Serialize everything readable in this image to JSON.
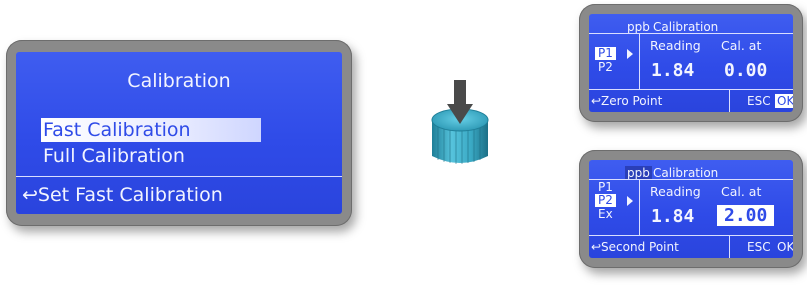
{
  "big_display": {
    "title": "Calibration",
    "menu_items": [
      "Fast Calibration",
      "Full Calibration"
    ],
    "hint": "↩Set Fast Calibration"
  },
  "knob": {
    "icon": "rotary-knob-icon",
    "pointer": "down-arrow-icon"
  },
  "panel_zero": {
    "unit": "ppb",
    "title": "Calibration",
    "points": [
      "P1",
      "P2"
    ],
    "reading_label": "Reading",
    "cal_label": "Cal. at",
    "reading_value": "1.84",
    "cal_value": "0.00",
    "hint": "↩Zero Point",
    "esc": "ESC",
    "ok": "OK"
  },
  "panel_second": {
    "unit": "ppb",
    "title": "Calibration",
    "points": [
      "P1",
      "P2",
      "Ex"
    ],
    "reading_label": "Reading",
    "cal_label": "Cal. at",
    "reading_value": "1.84",
    "cal_value": "2.00",
    "hint": "↩Second Point",
    "esc": "ESC",
    "ok": "OK"
  },
  "colors": {
    "lcd_blue": "#2f4be8",
    "lcd_text": "#f2f4ff",
    "frame_gray": "#8a8a8a",
    "knob_teal": "#3aa9c4"
  }
}
